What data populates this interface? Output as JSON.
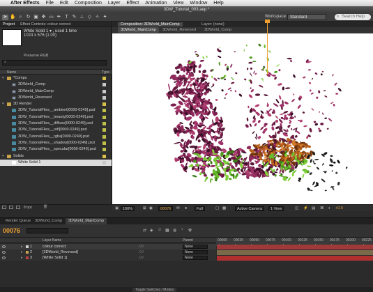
{
  "menubar": {
    "app": "After Effects",
    "items": [
      "File",
      "Edit",
      "Composition",
      "Layer",
      "Effect",
      "Animation",
      "View",
      "Window",
      "Help"
    ]
  },
  "window": {
    "title": "3DW_Tutorial_003.aep *"
  },
  "workspace": {
    "label": "Workspace:",
    "value": "Standard"
  },
  "search": {
    "placeholder": "Search Help"
  },
  "project": {
    "tab_project": "Project",
    "tab_effects": "Effect Controls: colour correct",
    "selected_name": "White Solid 1 ▾ , used 1 time",
    "selected_size": "1024 x 576 (1.00)",
    "preserve": "Preserve RGB",
    "col_name": "Name",
    "col_type": "Type",
    "bpc": "8 bpc",
    "items": [
      {
        "label": "*Comps",
        "kind": "folder",
        "indent": 0,
        "chip": "#d8c04a"
      },
      {
        "label": "3DWorld_Comp",
        "kind": "comp",
        "indent": 1,
        "chip": "#c8c8c8"
      },
      {
        "label": "3DWorld_MainComp",
        "kind": "comp",
        "indent": 1,
        "chip": "#c8c8c8"
      },
      {
        "label": "3DWorld_Reversed",
        "kind": "comp",
        "indent": 1,
        "chip": "#c8c8c8"
      },
      {
        "label": "3D Render",
        "kind": "folder",
        "indent": 0,
        "chip": "#d8c04a"
      },
      {
        "label": "3DW_TutorialFiles__ambient[0000-0249].psd",
        "kind": "footage",
        "indent": 1,
        "chip": "#c0c04a"
      },
      {
        "label": "3DW_TutorialFiles__beauty[0000-0249].psd",
        "kind": "footage",
        "indent": 1,
        "chip": "#c0c04a"
      },
      {
        "label": "3DW_TutorialFiles__diffuse[0000-0249].psd",
        "kind": "footage",
        "indent": 1,
        "chip": "#c0c04a"
      },
      {
        "label": "3DW_TutorialFiles__refl[0000-0249].psd",
        "kind": "footage",
        "indent": 1,
        "chip": "#c0c04a"
      },
      {
        "label": "3DW_TutorialFiles__rgba[0000-0249].psd",
        "kind": "footage",
        "indent": 1,
        "chip": "#c0c04a"
      },
      {
        "label": "3DW_TutorialFiles__shadow[0000-0249].psd",
        "kind": "footage",
        "indent": 1,
        "chip": "#c0c04a"
      },
      {
        "label": "3DW_TutorialFiles__specular[0000-0249].psd",
        "kind": "footage",
        "indent": 1,
        "chip": "#c0c04a"
      },
      {
        "label": "Solids",
        "kind": "folder",
        "indent": 0,
        "chip": "#d8c04a"
      },
      {
        "label": "White Solid 1",
        "kind": "solid",
        "indent": 1,
        "chip": "#c8c8c8",
        "selected": true
      }
    ]
  },
  "composition": {
    "tab": "Composition: 3DWorld_MainComp",
    "tab2": "Layer: (none)",
    "crumbs": [
      "3DWorld_MainComp",
      "3DWorld_Reversed",
      "3DWorld_Comp"
    ],
    "zoom": "100%",
    "timecode": "00076",
    "resolution": "Full",
    "camera": "Active Camera",
    "view": "1 View",
    "exposure": "+0.0"
  },
  "timeline": {
    "tabs": [
      "Render Queue",
      "3DWorld_Comp",
      "3DWorld_MainComp"
    ],
    "timecode": "00076",
    "col_layer": "Layer Name",
    "col_parent": "Parent",
    "ruler": [
      "00000",
      "00025",
      "00050",
      "00075",
      "00100",
      "00125",
      "00150",
      "00175",
      "00200",
      "00225"
    ],
    "footer": "Toggle Switches / Modes",
    "layers": [
      {
        "num": "1",
        "name": "colour correct",
        "label_color": "#d0d0d0",
        "bar_color": "#a03a3a",
        "parent": "None"
      },
      {
        "num": "2",
        "name": "[3DWorld_Reversed]",
        "label_color": "#c8a050",
        "bar_color": "#7a6a4a",
        "parent": "None"
      },
      {
        "num": "3",
        "name": "[White Solid 1]",
        "label_color": "#c04040",
        "bar_color": "#b03030",
        "parent": "None"
      }
    ]
  }
}
